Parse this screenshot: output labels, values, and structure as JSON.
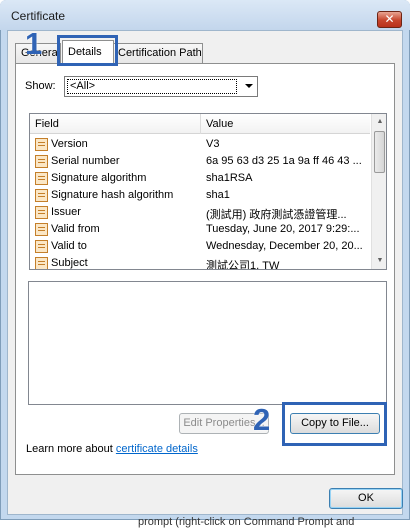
{
  "window": {
    "title": "Certificate",
    "close_glyph": "✕"
  },
  "tabs": [
    {
      "label": "General"
    },
    {
      "label": "Details"
    },
    {
      "label": "Certification Path"
    }
  ],
  "show": {
    "label": "Show:",
    "selected": "<All>"
  },
  "field_list": {
    "header_field": "Field",
    "header_value": "Value",
    "rows": [
      {
        "field": "Version",
        "value": "V3"
      },
      {
        "field": "Serial number",
        "value": "6a 95 63 d3 25 1a 9a ff 46 43 ..."
      },
      {
        "field": "Signature algorithm",
        "value": "sha1RSA"
      },
      {
        "field": "Signature hash algorithm",
        "value": "sha1"
      },
      {
        "field": "Issuer",
        "value": "(測試用) 政府測試憑證管理..."
      },
      {
        "field": "Valid from",
        "value": "Tuesday, June 20, 2017 9:29:..."
      },
      {
        "field": "Valid to",
        "value": "Wednesday, December 20, 20..."
      },
      {
        "field": "Subject",
        "value": "測試公司1, TW"
      }
    ]
  },
  "buttons": {
    "edit_properties": "Edit Properties...",
    "copy_to_file": "Copy to File...",
    "ok": "OK"
  },
  "learn_more": {
    "prefix": "Learn more about ",
    "link": "certificate details"
  },
  "callouts": {
    "one": "1",
    "two": "2"
  },
  "background_text": "prompt (right-click on Command Prompt and"
}
